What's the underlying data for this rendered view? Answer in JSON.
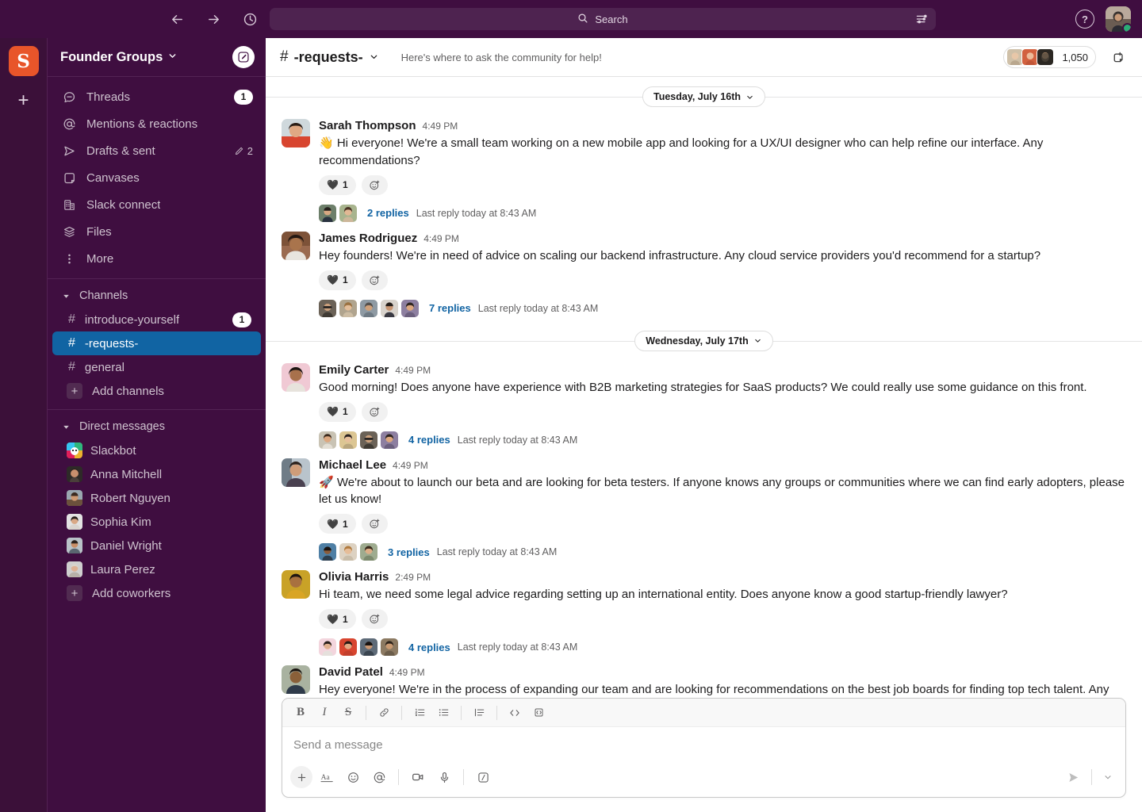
{
  "topbar": {
    "back_icon": "arrow-left-icon",
    "forward_icon": "arrow-right-icon",
    "history_icon": "clock-icon",
    "search_placeholder": "Search",
    "search_filter_icon": "filter-icon",
    "help_label": "?",
    "avatar_name": "avatar"
  },
  "rail": {
    "workspace_initial": "S",
    "add_label": "+"
  },
  "sidebar": {
    "workspace_name": "Founder Groups",
    "compose_icon": "compose-icon",
    "nav": [
      {
        "label": "Threads",
        "icon": "threads-icon",
        "badge": "1"
      },
      {
        "label": "Mentions & reactions",
        "icon": "at-icon",
        "badge": ""
      },
      {
        "label": "Drafts & sent",
        "icon": "send-icon",
        "draft_count": "2"
      },
      {
        "label": "Canvases",
        "icon": "canvas-icon",
        "badge": ""
      },
      {
        "label": "Slack connect",
        "icon": "slack-connect-icon",
        "badge": ""
      },
      {
        "label": "Files",
        "icon": "files-icon",
        "badge": ""
      },
      {
        "label": "More",
        "icon": "more-icon",
        "badge": ""
      }
    ],
    "channels_section": "Channels",
    "channels": [
      {
        "name": "introduce-yourself",
        "badge": "1",
        "active": false
      },
      {
        "name": "-requests-",
        "badge": "",
        "active": true
      },
      {
        "name": "general",
        "badge": "",
        "active": false
      }
    ],
    "add_channels_label": "Add channels",
    "dms_section": "Direct messages",
    "dms": [
      {
        "name": "Slackbot"
      },
      {
        "name": "Anna Mitchell"
      },
      {
        "name": "Robert Nguyen"
      },
      {
        "name": "Sophia Kim"
      },
      {
        "name": "Daniel Wright"
      },
      {
        "name": "Laura Perez"
      }
    ],
    "add_coworkers_label": "Add coworkers"
  },
  "channel_header": {
    "hash": "#",
    "name": "-requests-",
    "topic": "Here's where to ask the  community for help!",
    "member_count": "1,050",
    "canvas_icon": "new-canvas-icon"
  },
  "messages": [
    {
      "type": "divider",
      "label": "Tuesday, July 16th"
    },
    {
      "type": "message",
      "author": "Sarah Thompson",
      "time": "4:49 PM",
      "text": "👋 Hi everyone! We're a small team working on a new mobile app and looking for a UX/UI designer who can help refine our interface. Any recommendations?",
      "reaction_emoji": "🖤",
      "reaction_count": "1",
      "replies_label": "2 replies",
      "reply_meta": "Last reply today at 8:43 AM",
      "reply_avatars": 2,
      "avatar_color": "#d35c3c"
    },
    {
      "type": "message",
      "author": "James Rodriguez",
      "time": "4:49 PM",
      "text": "Hey founders! We're in need of advice on scaling our backend infrastructure. Any cloud service providers you'd recommend for a startup?",
      "reaction_emoji": "🖤",
      "reaction_count": "1",
      "replies_label": "7 replies",
      "reply_meta": "Last reply today at 8:43 AM",
      "reply_avatars": 5,
      "avatar_color": "#8d6a4f"
    },
    {
      "type": "divider",
      "label": "Wednesday, July 17th"
    },
    {
      "type": "message",
      "author": "Emily Carter",
      "time": "4:49 PM",
      "text": "Good morning! Does anyone have experience with B2B marketing strategies for SaaS products? We could really use some guidance on this front.",
      "reaction_emoji": "🖤",
      "reaction_count": "1",
      "replies_label": "4 replies",
      "reply_meta": "Last reply today at 8:43 AM",
      "reply_avatars": 4,
      "avatar_color": "#e0a8b5"
    },
    {
      "type": "message",
      "author": "Michael Lee",
      "time": "4:49 PM",
      "text": "🚀 We're about to launch our beta and are looking for beta testers. If anyone knows any groups or communities where we can find early adopters, please let us know!",
      "reaction_emoji": "🖤",
      "reaction_count": "1",
      "replies_label": "3 replies",
      "reply_meta": "Last reply today at 8:43 AM",
      "reply_avatars": 3,
      "avatar_color": "#6e7f93"
    },
    {
      "type": "message",
      "author": "Olivia Harris",
      "time": "2:49 PM",
      "text": "Hi team, we need some legal advice regarding setting up an international entity. Does anyone know a good startup-friendly lawyer?",
      "reaction_emoji": "🖤",
      "reaction_count": "1",
      "replies_label": "4 replies",
      "reply_meta": "Last reply today at 8:43 AM",
      "reply_avatars": 4,
      "avatar_color": "#c9a227"
    },
    {
      "type": "message",
      "author": "David Patel",
      "time": "4:49 PM",
      "text": "Hey everyone! We're in the process of expanding our team and are looking for recommendations on the best job boards for finding top tech talent. Any",
      "reaction_emoji": "",
      "reaction_count": "",
      "replies_label": "",
      "reply_meta": "",
      "reply_avatars": 0,
      "avatar_color": "#7a6a58"
    }
  ],
  "composer": {
    "placeholder": "Send a message",
    "format_buttons": [
      {
        "icon": "bold-icon",
        "label": "B"
      },
      {
        "icon": "italic-icon",
        "label": "I"
      },
      {
        "icon": "strikethrough-icon",
        "label": "S"
      },
      {
        "icon": "link-icon",
        "label": ""
      },
      {
        "icon": "ordered-list-icon",
        "label": ""
      },
      {
        "icon": "bulleted-list-icon",
        "label": ""
      },
      {
        "icon": "blockquote-icon",
        "label": ""
      },
      {
        "icon": "code-icon",
        "label": ""
      },
      {
        "icon": "code-block-icon",
        "label": ""
      }
    ],
    "action_buttons": [
      {
        "icon": "plus-icon"
      },
      {
        "icon": "text-format-icon"
      },
      {
        "icon": "emoji-icon"
      },
      {
        "icon": "mention-icon"
      },
      {
        "icon": "video-icon"
      },
      {
        "icon": "audio-icon"
      },
      {
        "icon": "slash-command-icon"
      }
    ],
    "send_icon": "send-icon",
    "send_caret_icon": "chevron-down-icon"
  },
  "colors": {
    "sidebar_bg": "#3f0e40",
    "rail_bg": "#3b1039",
    "active_channel": "#1164a3",
    "brand_orange": "#e8552a",
    "link_blue": "#1264a3",
    "presence_green": "#2bac76"
  }
}
